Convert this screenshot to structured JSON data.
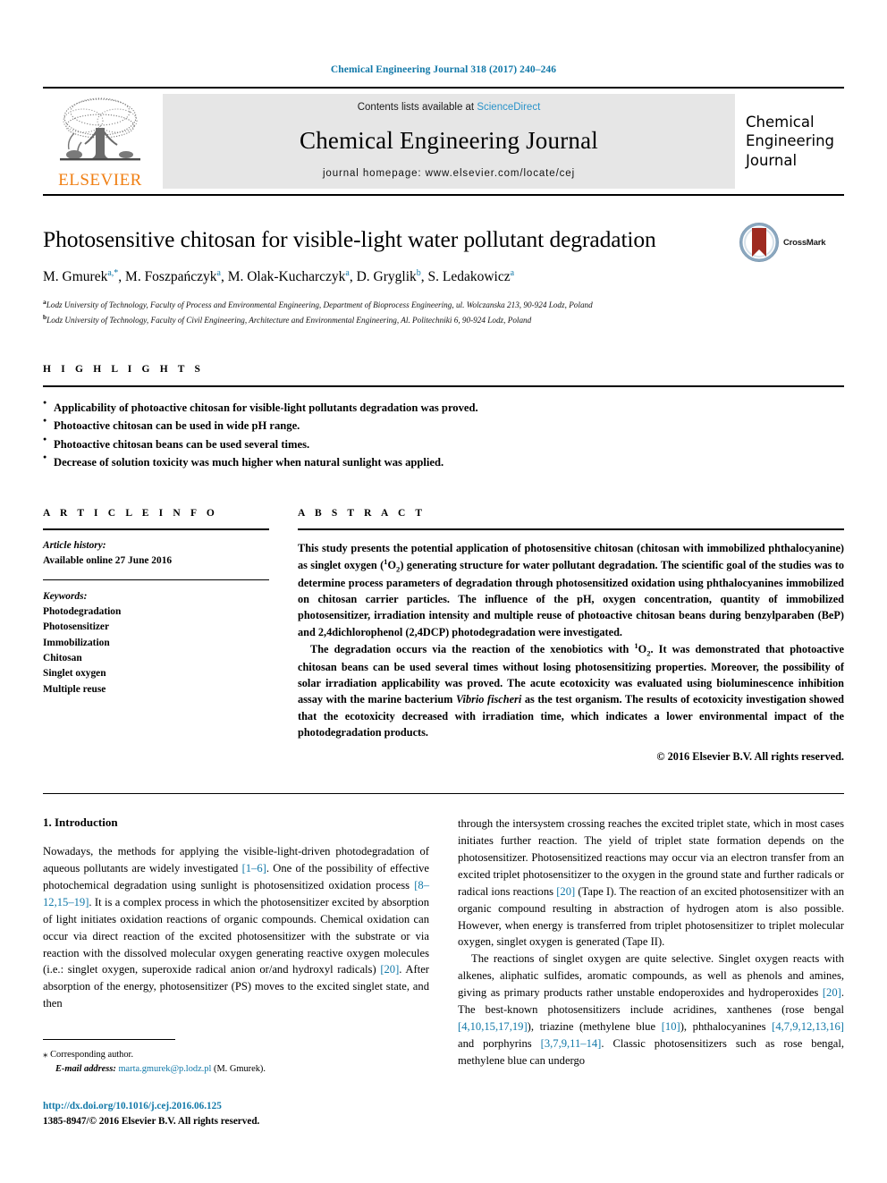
{
  "running_head": "Chemical Engineering Journal 318 (2017) 240–246",
  "masthead": {
    "contents_prefix": "Contents lists available at ",
    "sciencedirect": "ScienceDirect",
    "journal_title": "Chemical Engineering Journal",
    "homepage": "journal homepage: www.elsevier.com/locate/cej",
    "elsevier_word": "ELSEVIER",
    "cover_line1": "Chemical",
    "cover_line2": "Engineering",
    "cover_line3": "Journal",
    "sciencedirect_color": "#2a93c9",
    "elsevier_orange": "#f07f13"
  },
  "article": {
    "title": "Photosensitive chitosan for visible-light water pollutant degradation",
    "crossmark_label": "CrossMark",
    "authors": [
      {
        "name": "M. Gmurek",
        "marks": "a,*"
      },
      {
        "name": "M. Foszpańczyk",
        "marks": "a"
      },
      {
        "name": "M. Olak-Kucharczyk",
        "marks": "a"
      },
      {
        "name": "D. Gryglik",
        "marks": "b"
      },
      {
        "name": "S. Ledakowicz",
        "marks": "a"
      }
    ],
    "affiliations": [
      {
        "mark": "a",
        "text": "Lodz University of Technology, Faculty of Process and Environmental Engineering, Department of Bioprocess Engineering, ul. Wolczanska 213, 90-924 Lodz, Poland"
      },
      {
        "mark": "b",
        "text": "Lodz University of Technology, Faculty of Civil Engineering, Architecture and Environmental Engineering, Al. Politechniki 6, 90-924 Lodz, Poland"
      }
    ],
    "link_color": "#1178a8"
  },
  "highlights": {
    "heading": "H I G H L I G H T S",
    "items": [
      "Applicability of photoactive chitosan for visible-light pollutants degradation was proved.",
      "Photoactive chitosan can be used in wide pH range.",
      "Photoactive chitosan beans can be used several times.",
      "Decrease of solution toxicity was much higher when natural sunlight was applied."
    ]
  },
  "article_info": {
    "heading": "A R T I C L E   I N F O",
    "history_label": "Article history:",
    "history_value": "Available online 27 June 2016",
    "keywords_label": "Keywords:",
    "keywords": [
      "Photodegradation",
      "Photosensitizer",
      "Immobilization",
      "Chitosan",
      "Singlet oxygen",
      "Multiple reuse"
    ]
  },
  "abstract": {
    "heading": "A B S T R A C T",
    "para1_a": "This study presents the potential application of photosensitive chitosan (chitosan with immobilized phthalocyanine) as singlet oxygen (",
    "para1_sup": "1",
    "para1_o": "O",
    "para1_sub": "2",
    "para1_b": ") generating structure for water pollutant degradation. The scientific goal of the studies was to determine process parameters of degradation through photosensitized oxidation using phthalocyanines immobilized on chitosan carrier particles. The influence of the pH, oxygen concentration, quantity of immobilized photosensitizer, irradiation intensity and multiple reuse of photoactive chitosan beans during benzylparaben (BeP) and 2,4dichlorophenol (2,4DCP) photodegradation were investigated.",
    "para2_a": "The degradation occurs via the reaction of the xenobiotics with ",
    "para2_sup": "1",
    "para2_o": "O",
    "para2_sub": "2",
    "para2_b": ". It was demonstrated that photoactive chitosan beans can be used several times without losing photosensitizing properties. Moreover, the possibility of solar irradiation applicability was proved. The acute ecotoxicity was evaluated using bioluminescence inhibition assay with the marine bacterium ",
    "para2_italic": "Vibrio fischeri",
    "para2_c": " as the test organism. The results of ecotoxicity investigation showed that the ecotoxicity decreased with irradiation time, which indicates a lower environmental impact of the photodegradation products.",
    "copyright": "© 2016 Elsevier B.V. All rights reserved."
  },
  "introduction": {
    "heading": "1. Introduction",
    "left_p1_t1": "Nowadays, the methods for applying the visible-light-driven photodegradation of aqueous pollutants are widely investigated ",
    "left_p1_r1": "[1–6]",
    "left_p1_t2": ". One of the possibility of effective photochemical degradation using sunlight is photosensitized oxidation process ",
    "left_p1_r2": "[8–12,15–19]",
    "left_p1_t3": ". It is a complex process in which the photosensitizer excited by absorption of light initiates oxidation reactions of organic compounds. Chemical oxidation can occur via direct reaction of the excited photosensitizer with the substrate or via reaction with the dissolved molecular oxygen generating reactive oxygen molecules (i.e.: singlet oxygen, superoxide radical anion or/and hydroxyl radicals) ",
    "left_p1_r3": "[20]",
    "left_p1_t4": ". After absorption of the energy, photosensitizer (PS) moves to the excited singlet state, and then",
    "right_p1_t1": "through the intersystem crossing reaches the excited triplet state, which in most cases initiates further reaction. The yield of triplet state formation depends on the photosensitizer. Photosensitized reactions may occur via an electron transfer from an excited triplet photosensitizer to the oxygen in the ground state and further radicals or radical ions reactions ",
    "right_p1_r1": "[20]",
    "right_p1_t2": " (Tape I). The reaction of an excited photosensitizer with an organic compound resulting in abstraction of hydrogen atom is also possible. However, when energy is transferred from triplet photosensitizer to triplet molecular oxygen, singlet oxygen is generated (Tape II).",
    "right_p2_t1": "The reactions of singlet oxygen are quite selective. Singlet oxygen reacts with alkenes, aliphatic sulfides, aromatic compounds, as well as phenols and amines, giving as primary products rather unstable endoperoxides and hydroperoxides ",
    "right_p2_r1": "[20]",
    "right_p2_t2": ". The best-known photosensitizers include acridines, xanthenes (rose bengal ",
    "right_p2_r2": "[4,10,15,17,19]",
    "right_p2_t3": "), triazine (methylene blue ",
    "right_p2_r3": "[10]",
    "right_p2_t4": "), phthalocyanines ",
    "right_p2_r4": "[4,7,9,12,13,16]",
    "right_p2_t5": " and porphyrins ",
    "right_p2_r5": "[3,7,9,11–14]",
    "right_p2_t6": ". Classic photosensitizers such as rose bengal, methylene blue can undergo"
  },
  "footnote": {
    "star": "⁎",
    "corresponding": "Corresponding author.",
    "email_label": "E-mail address:",
    "email": "marta.gmurek@p.lodz.pl",
    "email_owner": "(M. Gmurek).",
    "doi": "http://dx.doi.org/10.1016/j.cej.2016.06.125",
    "issn": "1385-8947/© 2016 Elsevier B.V. All rights reserved."
  }
}
